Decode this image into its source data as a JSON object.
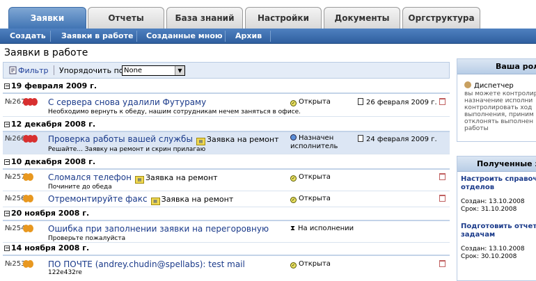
{
  "tabs": [
    {
      "label": "Заявки",
      "active": true
    },
    {
      "label": "Отчеты",
      "active": false
    },
    {
      "label": "База знаний",
      "active": false
    },
    {
      "label": "Настройки",
      "active": false
    },
    {
      "label": "Документы",
      "active": false
    },
    {
      "label": "Оргструктура",
      "active": false
    }
  ],
  "subnav": [
    "Создать",
    "Заявки в работе",
    "Созданные мною",
    "Архив"
  ],
  "page_title": "Заявки в работе",
  "filter": {
    "label": "Фильтр",
    "sort_label": "Упорядочить по:",
    "sort_value": "None"
  },
  "groups": [
    {
      "date": "19 февраля 2009 г.",
      "items": [
        {
          "num": "№267",
          "title": "С сервера снова удалили Футураму",
          "type": "",
          "desc": "Необходимо вернуть к обеду, нашим сотрудникам нечем заняться в офисе.",
          "status": "Открыта",
          "due": "26 февраля 2009 г."
        }
      ]
    },
    {
      "date": "12 декабря 2008 г.",
      "items": [
        {
          "num": "№266",
          "title": "Проверка работы вашей службы",
          "type": "Заявка на ремонт",
          "desc": "Решайте... Заявку на ремонт и скрин прилагаю",
          "status": "Назначен исполнитель",
          "status_l1": "Назначен",
          "status_l2": "исполнитель",
          "due": "24 февраля 2009 г."
        }
      ]
    },
    {
      "date": "10 декабря 2008 г.",
      "items": [
        {
          "num": "№257",
          "title": "Сломался телефон",
          "type": "Заявка на ремонт",
          "desc": "Почините до обеда",
          "status": "Открыта",
          "due": ""
        },
        {
          "num": "№256",
          "title": "Отремонтируйте факс",
          "type": "Заявка на ремонт",
          "desc": "",
          "status": "Открыта",
          "due": ""
        }
      ]
    },
    {
      "date": "20 ноября 2008 г.",
      "items": [
        {
          "num": "№254",
          "title": "Ошибка при заполнении заявки на перегоровную",
          "type": "",
          "desc": "Проверьте пожалуйста",
          "status": "На исполнении",
          "due": ""
        }
      ]
    },
    {
      "date": "14 ноября 2008 г.",
      "items": [
        {
          "num": "№253",
          "title": "ПО ПОЧТЕ (andrey.chudin@spellabs): test mail",
          "type": "",
          "desc": "122e432re",
          "status": "Открыта",
          "due": ""
        }
      ]
    }
  ],
  "role_panel": {
    "title": "Ваша рол",
    "role": "Диспетчер",
    "lines": [
      "вы можете контролир",
      "назначение исполни",
      "контролировать ход",
      "выполнения, приним",
      "отклонять выполнен",
      "работы"
    ]
  },
  "received_panel": {
    "title": "Полученные за",
    "tasks": [
      {
        "l1": "Настроить справоч",
        "l2": "отделов",
        "created": "Создан: 13.10.2008",
        "due": "Срок: 31.10.2008"
      },
      {
        "l1": "Подготовить отчет",
        "l2": "задачам",
        "created": "Создан: 13.10.2008",
        "due": "Срок: 30.10.2008"
      }
    ]
  },
  "colors": {
    "accent": "#3f73b3",
    "link": "#1a3a8a",
    "highlight_row": "#dce6f4",
    "priority_red": "#d83030",
    "priority_orange": "#e89820"
  }
}
